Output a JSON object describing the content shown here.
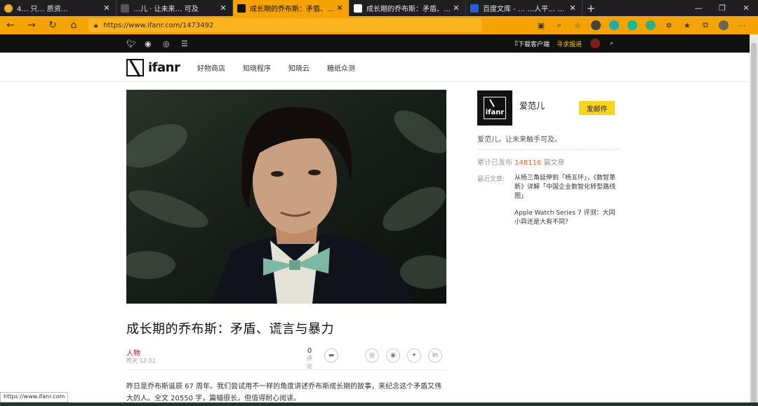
{
  "browser": {
    "tabs": [
      {
        "title": "4…      只…    质资…",
        "favicon_color": "#4a4a4a"
      },
      {
        "title": "…儿 · 让未来…    可及",
        "favicon_color": "#555555"
      },
      {
        "title": "成长期的乔布斯：矛盾、谎言与暴",
        "favicon_color": "#111111"
      },
      {
        "title": "成长期的乔布斯：矛盾、谎言与",
        "favicon_color": "#111111"
      },
      {
        "title": "百度文库 - …  …人平…   提升",
        "favicon_color": "#2d5bd4"
      }
    ],
    "url": "https://www.ifanr.com/1473492",
    "accent": "#f5a300"
  },
  "site": {
    "top_download": "下载客户端",
    "top_seek": "寻求报道",
    "logo_text": "ifanr",
    "nav": [
      "好物商店",
      "知晓程序",
      "知晓云",
      "糖纸众测"
    ]
  },
  "article": {
    "title": "成长期的乔布斯：矛盾、谎言与暴力",
    "category": "人物",
    "time": "昨天 12:32",
    "comment_count": "0",
    "comment_label": "评论",
    "body": "昨日是乔布斯诞辰 67 周年。我们尝试用不一样的角度讲述乔布斯成长期的故事，来纪念这个矛盾又伟大的人。全文 20550 字，篇幅很长，但值得耐心阅读。"
  },
  "sidebar": {
    "logo_text": "ifanr",
    "name": "爱范儿",
    "mail_button": "发邮件",
    "desc": "爱范儿，让未来触手可及。",
    "count_prefix": "累计已发布",
    "count": "148116",
    "count_suffix": "篇文章",
    "recent_label": "最近文章:",
    "recent": [
      "从杨三角延伸到「杨五环」，《数智革新》详解「中国企业数智化转型路线图」",
      "Apple Watch Series 7 评测：大同小异还是大有不同？"
    ]
  },
  "status_url": "https://www.ifanr.com"
}
